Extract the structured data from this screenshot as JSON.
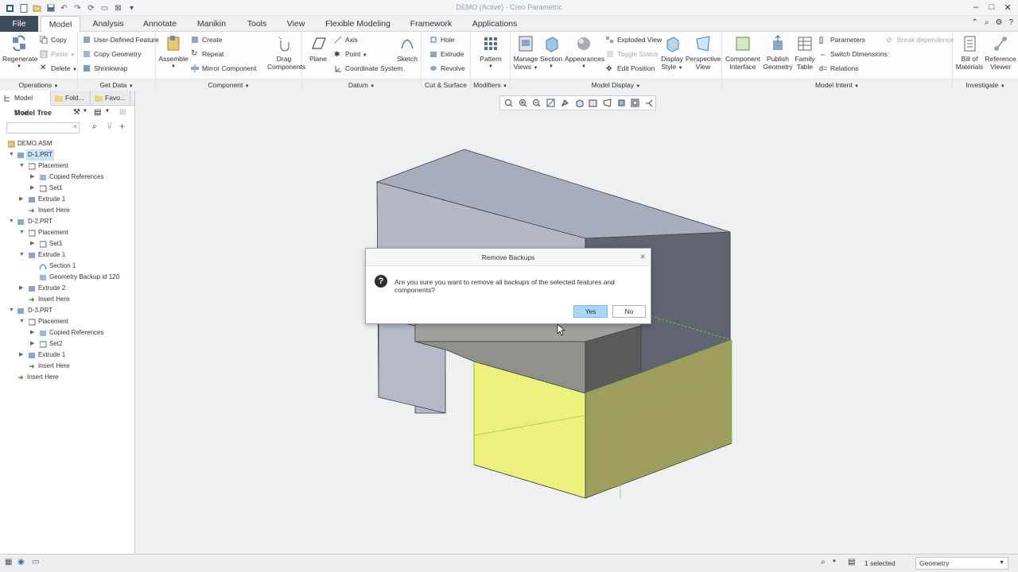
{
  "window": {
    "title": "DEMO (Active) - Creo Parametric"
  },
  "menu_tabs": [
    "File",
    "Model",
    "Analysis",
    "Annotate",
    "Manikin",
    "Tools",
    "View",
    "Flexible Modeling",
    "Framework",
    "Applications"
  ],
  "ribbon": {
    "operations": {
      "label": "Operations",
      "regenerate": "Regenerate",
      "copy": "Copy",
      "paste": "Paste",
      "delete": "Delete"
    },
    "get_data": {
      "label": "Get Data",
      "udf": "User-Defined Feature",
      "copy_geometry": "Copy Geometry",
      "shrinkwrap": "Shrinkwrap"
    },
    "component": {
      "label": "Component",
      "assemble": "Assemble",
      "create": "Create",
      "repeat": "Repeat",
      "mirror": "Mirror Component",
      "drag": "Drag",
      "components": "Components"
    },
    "datum": {
      "label": "Datum",
      "plane": "Plane",
      "axis": "Axis",
      "point": "Point",
      "csys": "Coordinate System",
      "sketch": "Sketch"
    },
    "cut_surface": {
      "label": "Cut & Surface",
      "hole": "Hole",
      "extrude": "Extrude",
      "revolve": "Revolve"
    },
    "modifiers": {
      "label": "Modifiers",
      "pattern": "Pattern"
    },
    "model_display": {
      "label": "Model Display",
      "manage": "Manage",
      "views": "Views",
      "section": "Section",
      "appearances": "Appearances",
      "exploded": "Exploded View",
      "toggle": "Toggle Status",
      "edit_pos": "Edit Position",
      "display": "Display",
      "style": "Style",
      "perspective": "Perspective",
      "view": "View"
    },
    "model_intent": {
      "label": "Model Intent",
      "component": "Component",
      "interface": "Interface",
      "publish": "Publish",
      "geometry": "Geometry",
      "family": "Family",
      "table": "Table",
      "parameters": "Parameters",
      "switch_dims": "Switch Dimensions",
      "relations": "Relations",
      "break_dep": "Break dependence"
    },
    "investigate": {
      "label": "Investigate",
      "bill": "Bill of",
      "materials": "Materials",
      "reference": "Reference",
      "viewer": "Viewer"
    }
  },
  "left_panel": {
    "tabs": [
      "Model Tree",
      "Fold...",
      "Favo..."
    ],
    "header": "Model Tree",
    "search_placeholder": "",
    "tree": [
      "DEMO.ASM",
      "D-1.PRT",
      "Placement",
      "Copied References",
      "Set1",
      "Extrude 1",
      "Insert Here",
      "D-2.PRT",
      "Placement",
      "Set1",
      "Extrude 1",
      "Section 1",
      "Geometry Backup id 120",
      "Extrude 2",
      "Insert Here",
      "D-3.PRT",
      "Placement",
      "Copied References",
      "Set2",
      "Extrude 1",
      "Insert Here",
      "Insert Here"
    ]
  },
  "dialog": {
    "title": "Remove Backups",
    "message": "Are you sure you want to remove all backups of the selected features and components?",
    "yes": "Yes",
    "no": "No"
  },
  "status": {
    "selected": "1 selected",
    "filter": "Geometry"
  },
  "colors": {
    "file_tab": "#3c4a59",
    "highlight_yellow": "#ecef7c",
    "box_gray": "#a9aebd",
    "selection_blue": "#c7e3fb"
  }
}
